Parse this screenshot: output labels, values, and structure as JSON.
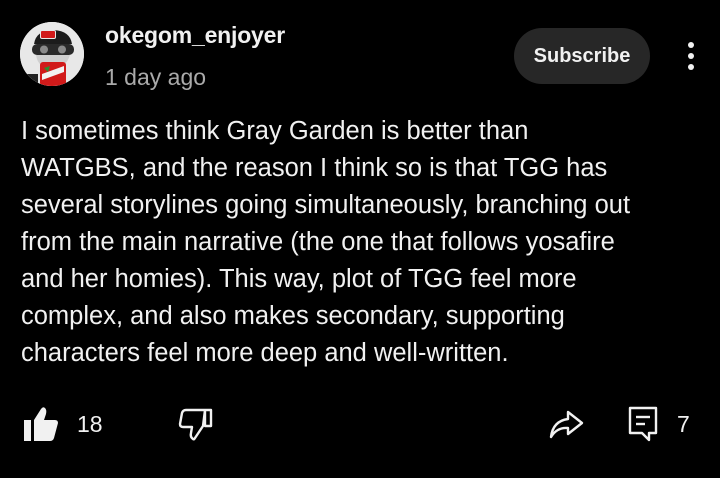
{
  "comment": {
    "username": "okegom_enjoyer",
    "timestamp": "1 day ago",
    "text": "I sometimes think Gray Garden is better than\nWATGBS, and the reason I think so is that TGG has\nseveral storylines going simultaneously, branching out\nfrom the main narrative (the one that follows yosafire\nand her homies). This way, plot of TGG feel more\ncomplex, and also makes secondary, supporting\ncharacters feel more deep and well-written."
  },
  "header": {
    "subscribe_label": "Subscribe",
    "avatar_icon": "avatar-icon",
    "more_icon": "more-vertical-icon"
  },
  "actions": {
    "like_icon": "thumbs-up-icon",
    "like_count": "18",
    "dislike_icon": "thumbs-down-icon",
    "share_icon": "share-icon",
    "reply_icon": "comment-icon",
    "reply_count": "7"
  },
  "colors": {
    "background": "#000000",
    "text": "#f1f1f1",
    "secondary_text": "#aaaaaa",
    "button_bg": "#272727"
  }
}
